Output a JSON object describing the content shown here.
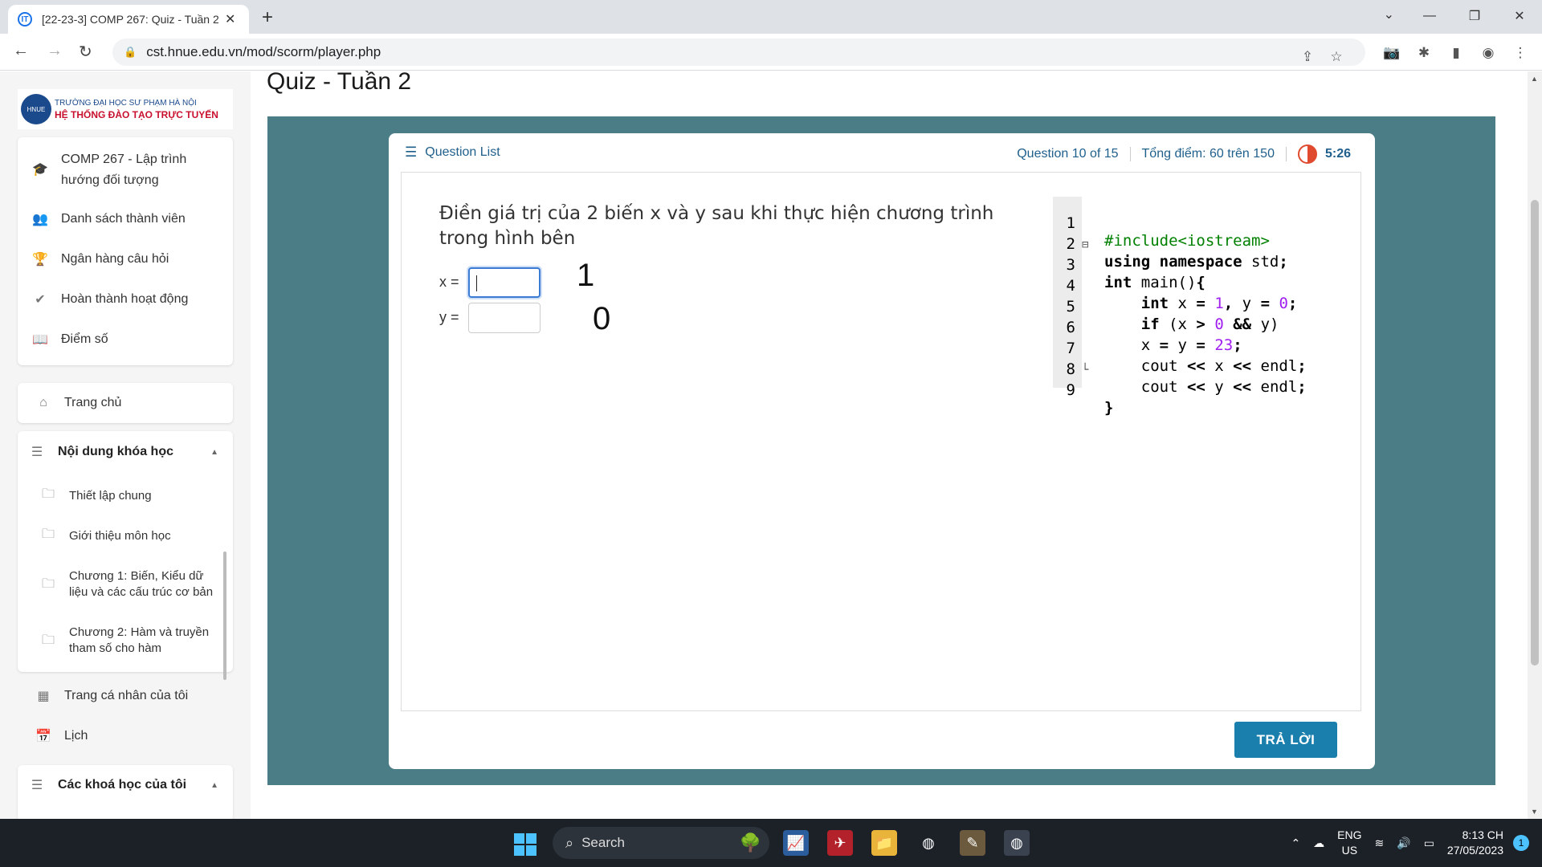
{
  "browser": {
    "tab_title": "[22-23-3] COMP 267: Quiz - Tuần 2",
    "favicon": "IT",
    "url": "cst.hnue.edu.vn/mod/scorm/player.php"
  },
  "logo": {
    "seal_text": "HNUE",
    "line1": "TRƯỜNG ĐẠI HỌC SƯ PHẠM HÀ NỘI",
    "line2": "HỆ THỐNG ĐÀO TẠO TRỰC TUYẾN"
  },
  "sidebar": {
    "course_items": [
      {
        "label": "COMP 267 - Lập trình hướng đối tượng",
        "icon": "graduation-cap-icon"
      },
      {
        "label": "Danh sách thành viên",
        "icon": "users-icon"
      },
      {
        "label": "Ngân hàng câu hỏi",
        "icon": "trophy-icon"
      },
      {
        "label": "Hoàn thành hoạt động",
        "icon": "check-icon"
      },
      {
        "label": "Điểm số",
        "icon": "book-icon"
      }
    ],
    "home": "Trang chủ",
    "course_content": {
      "title": "Nội dung khóa học",
      "items": [
        "Thiết lập chung",
        "Giới thiệu môn học",
        "Chương 1: Biến, Kiểu dữ liệu và các cấu trúc cơ bản",
        "Chương 2: Hàm và truyền tham số cho hàm"
      ]
    },
    "personal_page": "Trang cá nhân của tôi",
    "calendar": "Lịch",
    "my_courses": "Các khoá học của tôi"
  },
  "page": {
    "title": "Quiz - Tuần 2"
  },
  "quiz": {
    "question_list_label": "Question List",
    "question_counter": "Question 10 of 15",
    "total_score": "Tổng điểm: 60 trên 150",
    "timer": "5:26",
    "question_text": "Điền giá trị của 2 biến x và y sau khi thực hiện chương trình trong hình bên",
    "x_label": "x =",
    "y_label": "y =",
    "x_value": "",
    "y_value": "",
    "handwritten_x": "1",
    "handwritten_y": "0",
    "answer_button": "TRẢ LỜI",
    "code_lines": [
      {
        "n": "1",
        "fold": ""
      },
      {
        "n": "2",
        "fold": ""
      },
      {
        "n": "3",
        "fold": "⊟"
      },
      {
        "n": "4",
        "fold": ""
      },
      {
        "n": "5",
        "fold": ""
      },
      {
        "n": "6",
        "fold": ""
      },
      {
        "n": "7",
        "fold": ""
      },
      {
        "n": "8",
        "fold": ""
      },
      {
        "n": "9",
        "fold": "└"
      }
    ]
  },
  "taskbar": {
    "search_label": "Search",
    "lang_top": "ENG",
    "lang_bottom": "US",
    "time": "8:13 CH",
    "date": "27/05/2023",
    "notification_count": "1"
  }
}
